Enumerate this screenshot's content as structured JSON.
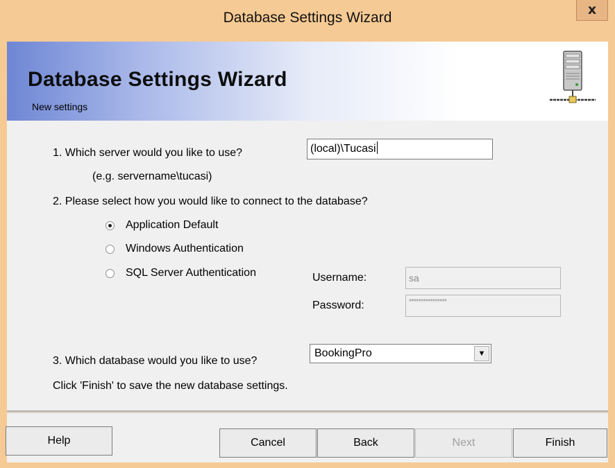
{
  "window": {
    "title": "Database Settings Wizard",
    "close_glyph": "x"
  },
  "header": {
    "title": "Database Settings Wizard",
    "subtitle": "New settings",
    "icon": "server-network-icon"
  },
  "step1": {
    "question": "1. Which server would you like to use?",
    "hint": "(e.g. servername\\tucasi)",
    "server_value": "(local)\\Tucasi"
  },
  "step2": {
    "question": "2. Please select how you would like to connect to the database?",
    "options": [
      {
        "label": "Application Default",
        "selected": true
      },
      {
        "label": "Windows Authentication",
        "selected": false
      },
      {
        "label": "SQL Server Authentication",
        "selected": false
      }
    ],
    "username_label": "Username:",
    "username_value": "sa",
    "password_label": "Password:",
    "password_value": "****************"
  },
  "step3": {
    "question": "3. Which database would you like to use?",
    "selected_database": "BookingPro",
    "dropdown_arrow": "▼"
  },
  "instruction": "Click 'Finish' to save the new database settings.",
  "buttons": {
    "help": "Help",
    "cancel": "Cancel",
    "back": "Back",
    "next": "Next",
    "finish": "Finish"
  },
  "colors": {
    "titlebar": "#f6ca94",
    "header_gradient_start": "#6e86d4",
    "dialog_bg": "#f0f0f0"
  }
}
